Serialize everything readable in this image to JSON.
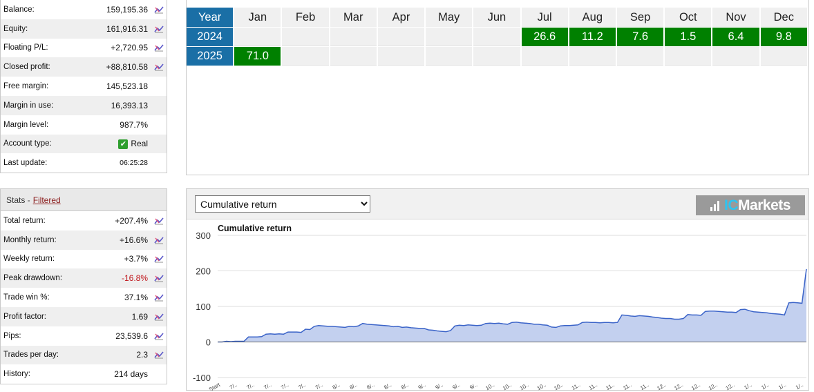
{
  "account": {
    "rows": [
      {
        "label": "Balance:",
        "value": "159,195.36"
      },
      {
        "label": "Equity:",
        "value": "161,916.31"
      },
      {
        "label": "Floating P/L:",
        "value": "+2,720.95"
      },
      {
        "label": "Closed profit:",
        "value": "+88,810.58"
      },
      {
        "label": "Free margin:",
        "value": "145,523.18"
      },
      {
        "label": "Margin in use:",
        "value": "16,393.13"
      },
      {
        "label": "Margin level:",
        "value": "987.7%"
      },
      {
        "label": "Account type:",
        "value": "Real"
      },
      {
        "label": "Last update:",
        "value": "06:25:28"
      }
    ]
  },
  "stats": {
    "title": "Stats -",
    "filter_link": "Filtered",
    "rows": [
      {
        "label": "Total return:",
        "value": "+207.4%"
      },
      {
        "label": "Monthly return:",
        "value": "+16.6%"
      },
      {
        "label": "Weekly return:",
        "value": "+3.7%"
      },
      {
        "label": "Peak drawdown:",
        "value": "-16.8%"
      },
      {
        "label": "Trade win %:",
        "value": "37.1%"
      },
      {
        "label": "Profit factor:",
        "value": "1.69"
      },
      {
        "label": "Pips:",
        "value": "23,539.6"
      },
      {
        "label": "Trades per day:",
        "value": "2.3"
      },
      {
        "label": "History:",
        "value": "214 days"
      }
    ]
  },
  "monthly": {
    "year_header": "Year",
    "months": [
      "Jan",
      "Feb",
      "Mar",
      "Apr",
      "May",
      "Jun",
      "Jul",
      "Aug",
      "Sep",
      "Oct",
      "Nov",
      "Dec"
    ],
    "rows": [
      {
        "year": "2024",
        "cells": [
          "",
          "",
          "",
          "",
          "",
          "",
          "26.6",
          "11.2",
          "7.6",
          "1.5",
          "6.4",
          "9.8"
        ]
      },
      {
        "year": "2025",
        "cells": [
          "71.0",
          "",
          "",
          "",
          "",
          "",
          "",
          "",
          "",
          "",
          "",
          ""
        ]
      }
    ]
  },
  "chart_select": {
    "selected": "Cumulative return",
    "options": [
      "Cumulative return"
    ]
  },
  "logo": {
    "prefix": "IC",
    "suffix": "Markets"
  },
  "colors": {
    "year_blue": "#1a6fa6",
    "positive_green": "#008000",
    "negative_red": "#c0151b",
    "area_fill": "#c3d0ef",
    "line": "#3a63c8"
  },
  "icons": {
    "row_action": "chart-trend-icon",
    "account_type": "checkmark-icon"
  },
  "chart_data": {
    "type": "area",
    "title": "Cumulative return",
    "ylim": [
      -100,
      300
    ],
    "yticks": [
      300,
      200,
      100,
      0,
      -100
    ],
    "x_first_label": "Start",
    "x_tick_labels": [
      "Start",
      "7/..",
      "7/..",
      "7/..",
      "7/..",
      "7/..",
      "7/..",
      "8/..",
      "8/..",
      "8/..",
      "8/..",
      "8/..",
      "9/..",
      "9/..",
      "9/..",
      "9/..",
      "10..",
      "10..",
      "10..",
      "10..",
      "10..",
      "11..",
      "11..",
      "11..",
      "11..",
      "11..",
      "12..",
      "12..",
      "12..",
      "12..",
      "12..",
      "1/..",
      "1/..",
      "1/..",
      "1/.."
    ],
    "series": [
      {
        "values": [
          0,
          0,
          2,
          1,
          2,
          2,
          2,
          14,
          14,
          14,
          15,
          22,
          23,
          22,
          23,
          22,
          28,
          28,
          28,
          27,
          36,
          35,
          44,
          46,
          45,
          44,
          44,
          43,
          42,
          41,
          44,
          43,
          45,
          52,
          50,
          49,
          48,
          47,
          46,
          45,
          43,
          44,
          41,
          42,
          40,
          39,
          38,
          38,
          34,
          33,
          31,
          30,
          29,
          32,
          45,
          47,
          46,
          48,
          47,
          46,
          47,
          52,
          53,
          52,
          53,
          51,
          50,
          55,
          56,
          54,
          53,
          52,
          50,
          50,
          48,
          47,
          42,
          41,
          45,
          46,
          46,
          47,
          48,
          55,
          56,
          55,
          55,
          54,
          55,
          55,
          54,
          55,
          76,
          75,
          73,
          72,
          74,
          73,
          72,
          70,
          69,
          67,
          66,
          66,
          64,
          64,
          66,
          77,
          76,
          76,
          75,
          86,
          87,
          87,
          86,
          85,
          84,
          84,
          83,
          91,
          92,
          88,
          85,
          84,
          83,
          82,
          80,
          79,
          78,
          76,
          110,
          111,
          110,
          109,
          205
        ]
      }
    ]
  }
}
